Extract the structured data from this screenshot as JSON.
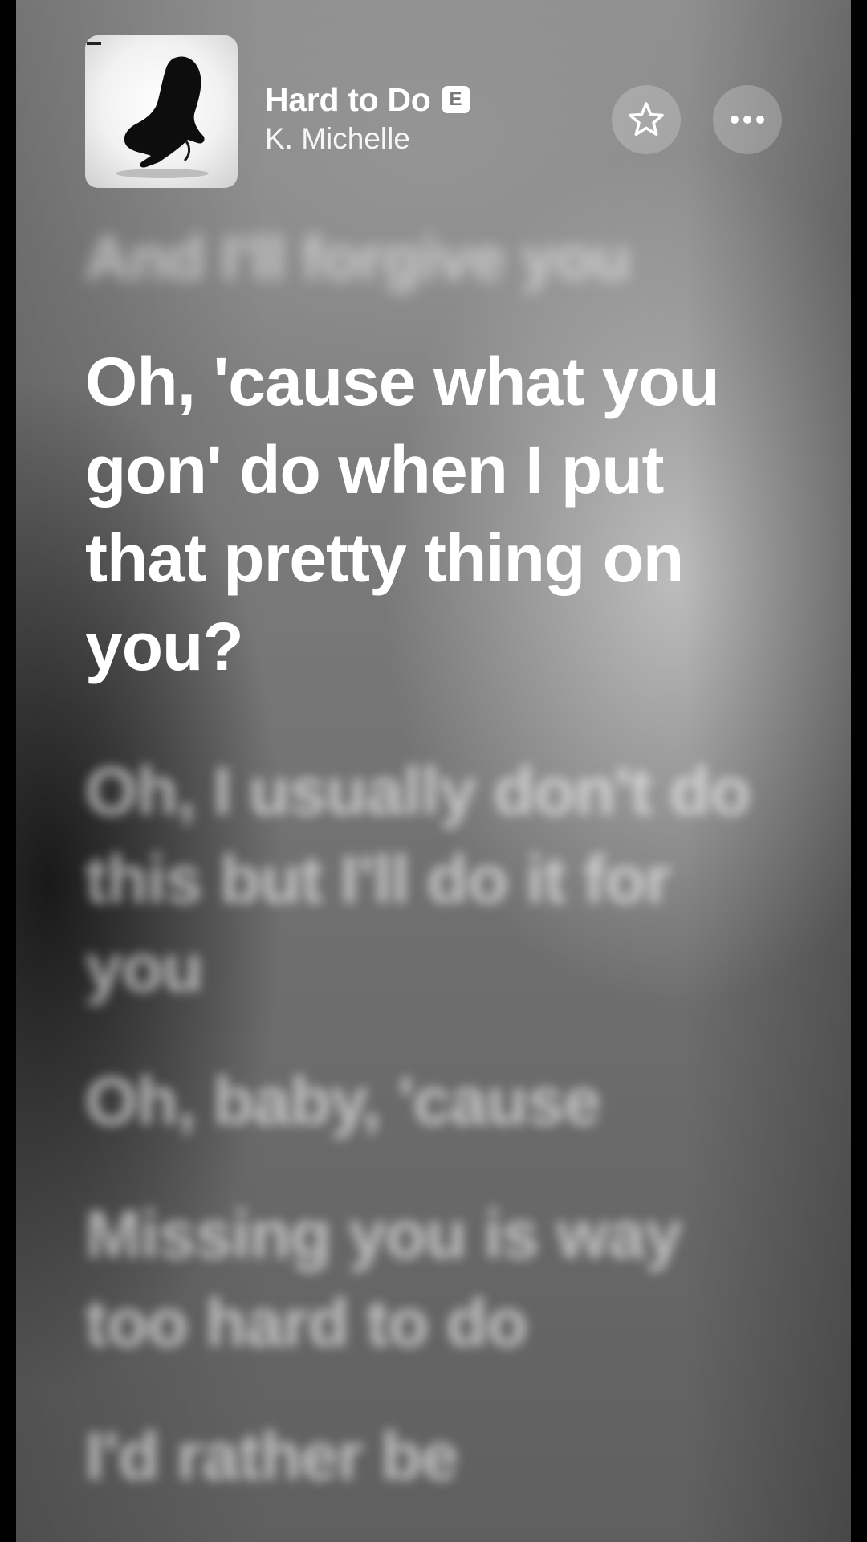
{
  "now_playing": {
    "title": "Hard to Do",
    "explicit_badge": "E",
    "artist": "K. Michelle"
  },
  "icons": {
    "favorite": "star-icon",
    "more": "ellipsis-icon"
  },
  "lyrics": {
    "previous": "And I'll forgive you",
    "current": "Oh, 'cause what you gon' do when I put that pretty thing on you?",
    "upcoming": [
      "Oh, I usually don't do this but I'll do it for you",
      "Oh, baby, 'cause",
      "Missing you is way too hard to do",
      "I'd rather be"
    ]
  }
}
